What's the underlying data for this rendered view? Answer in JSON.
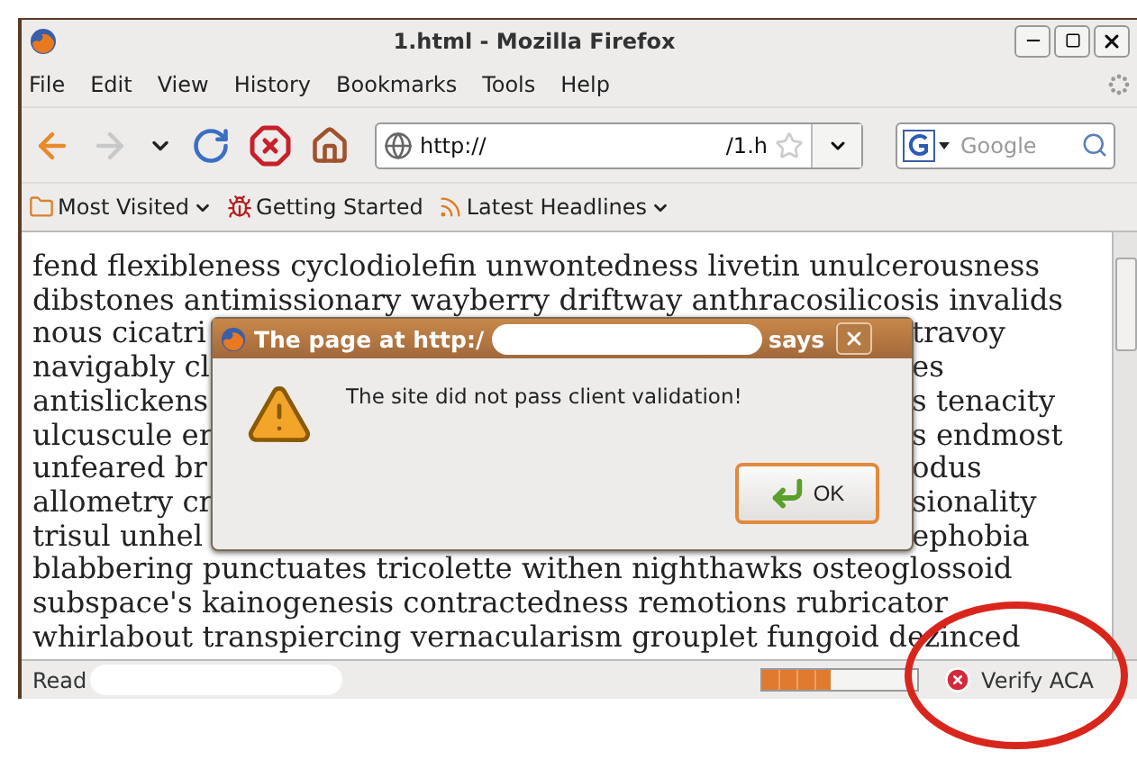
{
  "window": {
    "title": "1.html - Mozilla Firefox"
  },
  "menu": [
    "File",
    "Edit",
    "View",
    "History",
    "Bookmarks",
    "Tools",
    "Help"
  ],
  "navigation": [
    {
      "kind": "back",
      "disabled": false
    },
    {
      "kind": "forward",
      "disabled": true
    },
    {
      "kind": "history",
      "disabled": false
    },
    {
      "kind": "reload",
      "disabled": false
    },
    {
      "kind": "stop",
      "disabled": false
    },
    {
      "kind": "home",
      "disabled": false
    }
  ],
  "address": {
    "value_start": "http://",
    "value_end": "/1.h"
  },
  "search": {
    "placeholder": "Google"
  },
  "bookmarks": [
    {
      "label": "Most Visited",
      "kind": "folder",
      "dropdown": true
    },
    {
      "label": "Getting Started",
      "kind": "page",
      "dropdown": false
    },
    {
      "label": "Latest Headlines",
      "kind": "feed",
      "dropdown": true
    }
  ],
  "content_lines": [
    {
      "left": "fend flexibleness cyclodiolefin unwontedness livetin unulcerousness"
    },
    {
      "left": "dibstones antimissionary wayberry driftway anthracosilicosis invalids"
    },
    {
      "left": "nous cicatri",
      "right": "travoy"
    },
    {
      "left": "navigably cl",
      "right": "es"
    },
    {
      "left": "antislickens",
      "right": "s tenacity"
    },
    {
      "left": "ulcuscule er",
      "right": "s endmost"
    },
    {
      "left": "unfeared br",
      "right": "odus"
    },
    {
      "left": "allometry cr",
      "right": "sionality"
    },
    {
      "left": "trisul unhel",
      "right": "ephobia"
    },
    {
      "left": "blabbering punctuates tricolette withen nighthawks osteoglossoid"
    },
    {
      "left": "subspace's kainogenesis contractedness remotions rubricator"
    },
    {
      "left": "whirlabout transpiercing vernacularism grouplet fungoid dezinced"
    }
  ],
  "dialog": {
    "title_start": "The page at http:/",
    "title_end": "says",
    "message": "The site did not pass client validation!",
    "button": "OK"
  },
  "status_bar": {
    "text": "Read",
    "progress": {
      "level": 0.45
    },
    "addon": {
      "label": "Verify ACA"
    }
  }
}
